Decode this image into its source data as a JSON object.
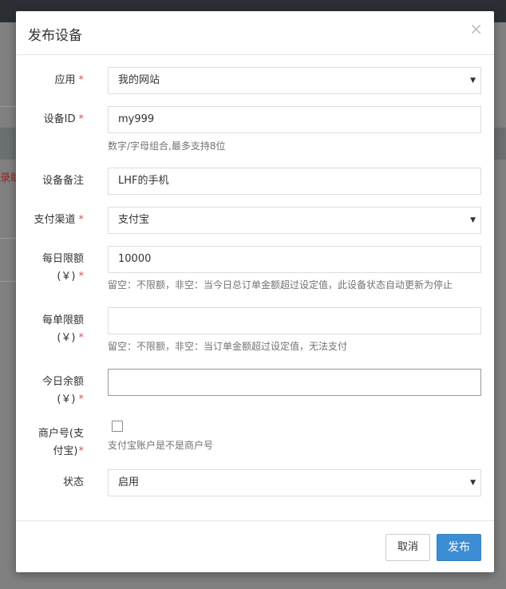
{
  "backdrop": {
    "partial_text": "录助"
  },
  "modal": {
    "title": "发布设备",
    "close_glyph": "×"
  },
  "form": {
    "app": {
      "label": "应用",
      "required": "*",
      "value": "我的网站"
    },
    "device_id": {
      "label": "设备ID",
      "required": "*",
      "value": "my999",
      "hint": "数字/字母组合,最多支持8位"
    },
    "device_note": {
      "label": "设备备注",
      "value": "LHF的手机"
    },
    "pay_channel": {
      "label": "支付渠道",
      "required": "*",
      "value": "支付宝"
    },
    "daily_limit": {
      "label_line1": "每日限额",
      "label_line2": "(￥)",
      "required": "*",
      "value": "10000",
      "hint": "留空：不限额，非空：当今日总订单金额超过设定值，此设备状态自动更新为停止"
    },
    "single_limit": {
      "label_line1": "每单限额",
      "label_line2": "(￥)",
      "required": "*",
      "value": "",
      "hint": "留空：不限额，非空：当订单金额超过设定值，无法支付"
    },
    "today_balance": {
      "label_line1": "今日余额",
      "label_line2": "(￥)",
      "required": "*",
      "value": ""
    },
    "merchant_no": {
      "label_line1": "商户号(支",
      "label_line2": "付宝)",
      "required": "*",
      "checked": false,
      "hint": "支付宝账户是不是商户号"
    },
    "status": {
      "label": "状态",
      "value": "启用"
    }
  },
  "footer": {
    "cancel_label": "取消",
    "submit_label": "发布"
  },
  "colors": {
    "primary": "#3c8dd4",
    "required": "#d9534f"
  },
  "icons": {
    "select_caret": "▼"
  }
}
